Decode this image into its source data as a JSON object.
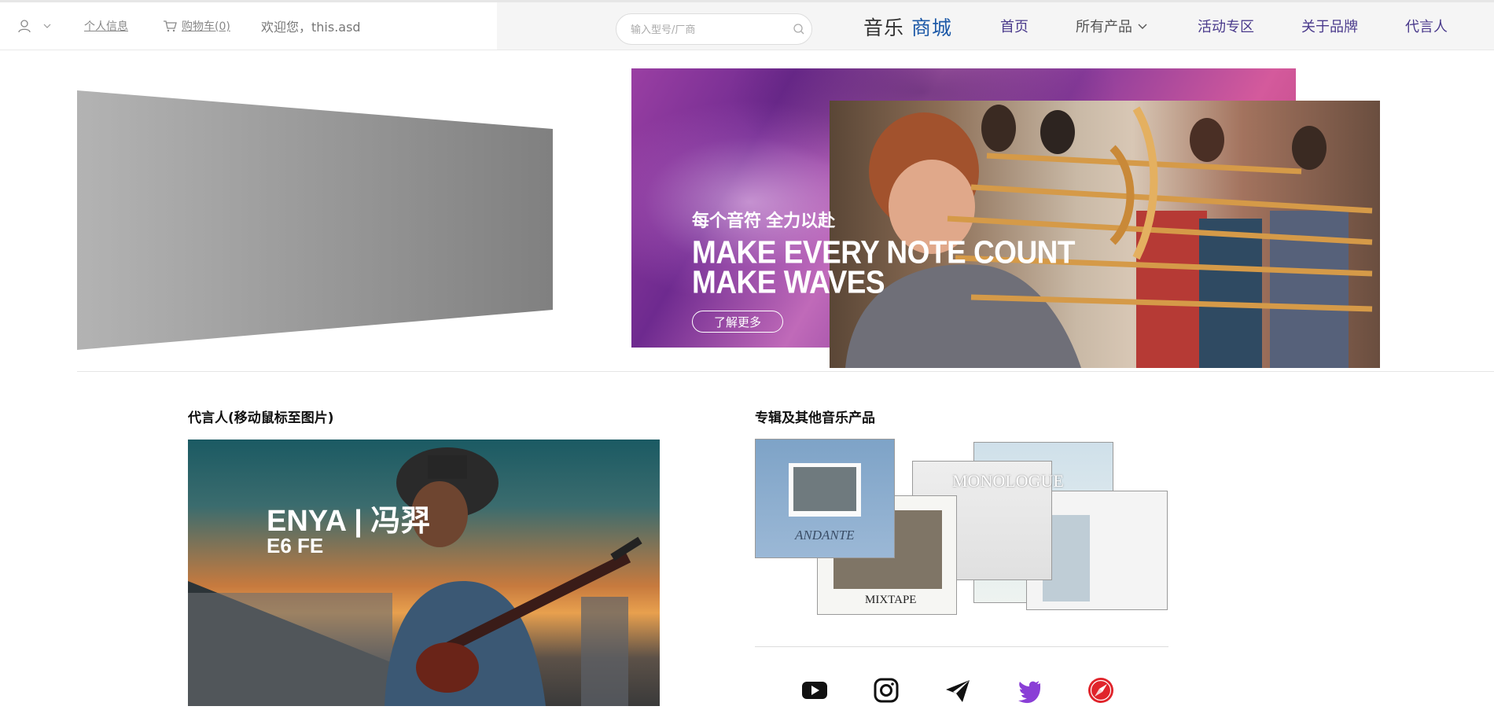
{
  "header": {
    "personal_info": "个人信息",
    "cart": "购物车(0)",
    "welcome": "欢迎您，this.asd",
    "search_placeholder": "输入型号/厂商",
    "brand_main": "音乐",
    "brand_accent": "商城",
    "nav": {
      "home": "首页",
      "all_products": "所有产品",
      "events": "活动专区",
      "about": "关于品牌",
      "spokesperson": "代言人"
    }
  },
  "banner": {
    "subtitle": "每个音符 全力以赴",
    "line1": "MAKE EVERY NOTE COUNT",
    "line2": "MAKE WAVES",
    "button": "了解更多"
  },
  "spokesperson_section": {
    "title": "代言人(移动鼠标至图片)",
    "name": "ENYA | 冯羿",
    "model": "E6 FE"
  },
  "albums_section": {
    "title": "专辑及其他音乐产品",
    "albums": [
      "ANDANTE",
      "MIXTAPE",
      "MONOLOGUE"
    ]
  },
  "social_icons": [
    "youtube-icon",
    "instagram-icon",
    "telegram-icon",
    "twitter-icon",
    "safari-icon"
  ],
  "colors": {
    "nav": "#4a3a8c",
    "brand_accent": "#1e5aa8",
    "twitter": "#8a3fd6",
    "safari": "#e0242b"
  }
}
